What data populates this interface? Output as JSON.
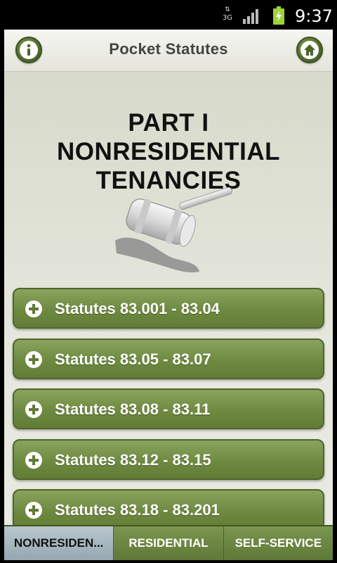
{
  "status_bar": {
    "network_type": "3G",
    "time": "9:37",
    "signal_icon": "signal-bars-icon",
    "battery_icon": "battery-charging-icon"
  },
  "header": {
    "title": "Pocket Statutes",
    "info_icon": "info-icon",
    "home_icon": "home-icon"
  },
  "main": {
    "page_title": "PART I NONRESIDENTIAL TENANCIES",
    "illustration": "gavel-icon",
    "statutes": [
      {
        "label": "Statutes 83.001 - 83.04"
      },
      {
        "label": "Statutes 83.05 - 83.07"
      },
      {
        "label": "Statutes 83.08 - 83.11"
      },
      {
        "label": "Statutes 83.12 - 83.15"
      },
      {
        "label": "Statutes 83.18 - 83.201"
      }
    ]
  },
  "tabs": [
    {
      "label": "NONRESIDEN...",
      "active": true
    },
    {
      "label": "RESIDENTIAL",
      "active": false
    },
    {
      "label": "SELF-SERVICE",
      "active": false
    }
  ],
  "colors": {
    "accent_green": "#6e8a40",
    "active_tab": "#95a7b0"
  }
}
